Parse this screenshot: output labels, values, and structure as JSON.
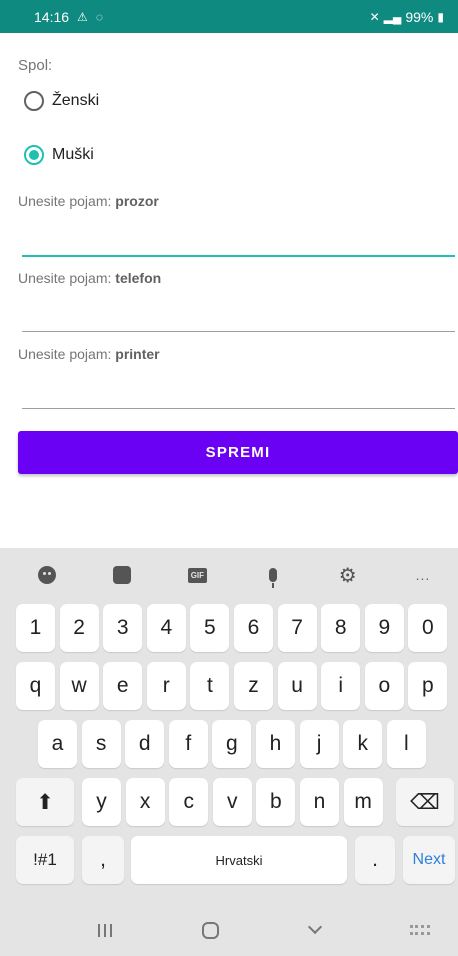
{
  "status_bar": {
    "time": "14:16",
    "battery": "99%",
    "accent_color": "#0f8a80"
  },
  "form": {
    "gender_label": "Spol:",
    "options": [
      {
        "label": "Ženski",
        "checked": false
      },
      {
        "label": "Muški",
        "checked": true
      }
    ],
    "prompt_prefix": "Unesite pojam:",
    "words": [
      "prozor",
      "telefon",
      "printer"
    ],
    "save_label": "SPREMI",
    "button_color": "#6a00f4",
    "radio_color": "#1ec1b1"
  },
  "keyboard": {
    "toolbar_icons": [
      "emoji-icon",
      "sticker-icon",
      "gif-icon",
      "mic-icon",
      "settings-icon",
      "more-icon"
    ],
    "gif_label": "GIF",
    "more_label": "...",
    "row1": [
      "1",
      "2",
      "3",
      "4",
      "5",
      "6",
      "7",
      "8",
      "9",
      "0"
    ],
    "row2": [
      "q",
      "w",
      "e",
      "r",
      "t",
      "z",
      "u",
      "i",
      "o",
      "p"
    ],
    "row3": [
      "a",
      "s",
      "d",
      "f",
      "g",
      "h",
      "j",
      "k",
      "l"
    ],
    "row4": [
      "y",
      "x",
      "c",
      "v",
      "b",
      "n",
      "m"
    ],
    "sym_label": "!#1",
    "comma_label": ",",
    "space_label": "Hrvatski",
    "period_label": ".",
    "next_label": "Next"
  }
}
